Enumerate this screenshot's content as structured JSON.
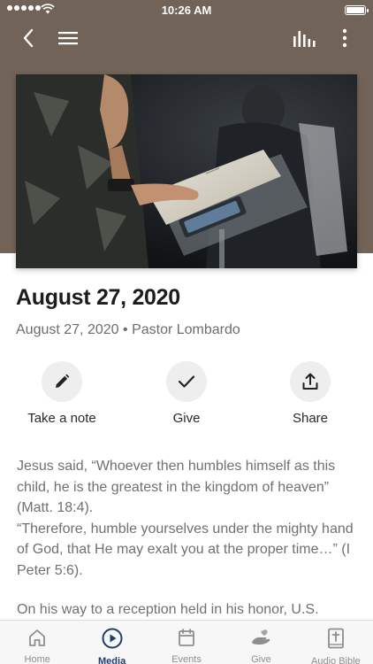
{
  "status_bar": {
    "time": "10:26 AM"
  },
  "colors": {
    "header_bg": "#726358",
    "accent": "#1f3e6e",
    "tab_inactive": "#8e8e8e"
  },
  "nav": {
    "icons": [
      "back-icon",
      "menu-icon",
      "audio-bars-icon",
      "more-vertical-icon"
    ]
  },
  "sermon": {
    "title": "August 27, 2020",
    "date": "August 27, 2020",
    "separator": "•",
    "speaker": "Pastor Lombardo"
  },
  "actions": [
    {
      "label": "Take a note",
      "icon": "pencil-icon"
    },
    {
      "label": "Give",
      "icon": "check-icon"
    },
    {
      "label": "Share",
      "icon": "share-icon"
    }
  ],
  "body": {
    "paragraph_1": "Jesus said, “Whoever then humbles himself as this child, he is the greatest in the kingdom of heaven” (Matt. 18:4).",
    "paragraph_2": "“Therefore, humble yourselves under the mighty hand of God, that He may exalt you at the proper time…” (I Peter 5:6).",
    "paragraph_3": "On his way to a reception held in his honor, U.S."
  },
  "tabs": [
    {
      "label": "Home",
      "icon": "home-icon",
      "active": false
    },
    {
      "label": "Media",
      "icon": "play-circle-icon",
      "active": true
    },
    {
      "label": "Events",
      "icon": "calendar-icon",
      "active": false
    },
    {
      "label": "Give",
      "icon": "giving-hand-icon",
      "active": false
    },
    {
      "label": "Audio Bible",
      "icon": "bible-icon",
      "active": false
    }
  ]
}
